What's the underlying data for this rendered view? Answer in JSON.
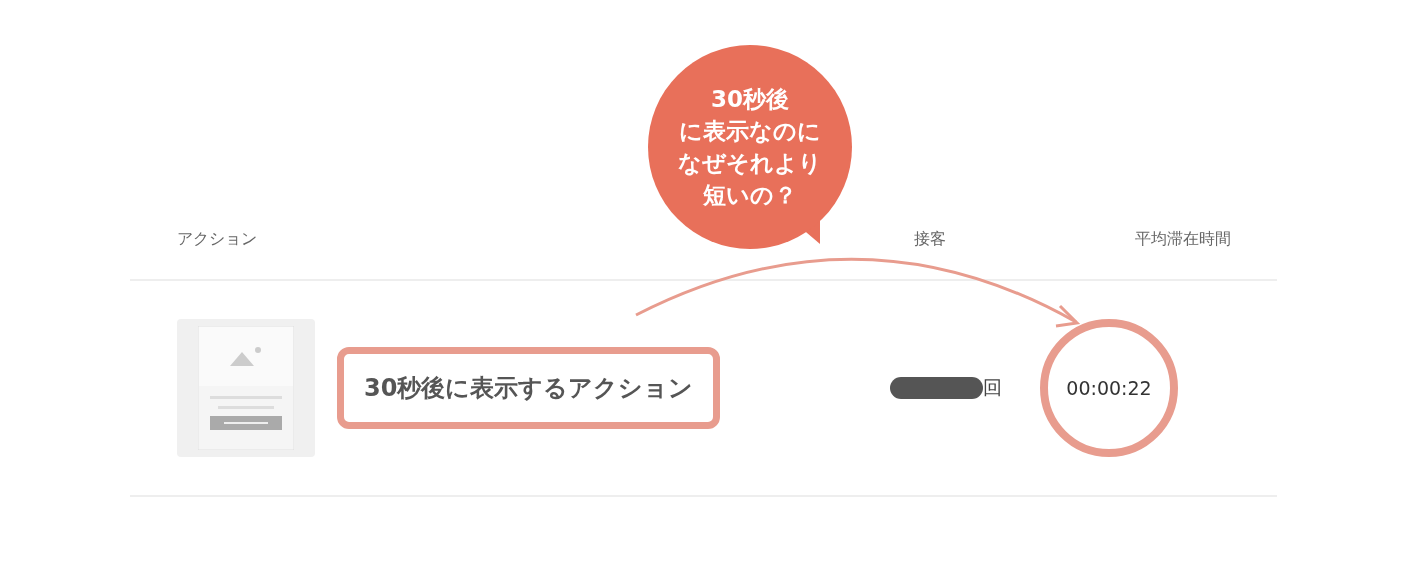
{
  "table": {
    "columns": [
      "アクション",
      "接客",
      "平均滞在時間"
    ],
    "rows": [
      {
        "action": "30秒後に表示するアクション",
        "highlighted": true,
        "count_suffix": "回",
        "average_time": "00:00:22",
        "time_circled": true
      }
    ]
  },
  "callout": {
    "lines": [
      "30秒後",
      "に表示なのに",
      "なぜそれより",
      "短いの？"
    ]
  }
}
